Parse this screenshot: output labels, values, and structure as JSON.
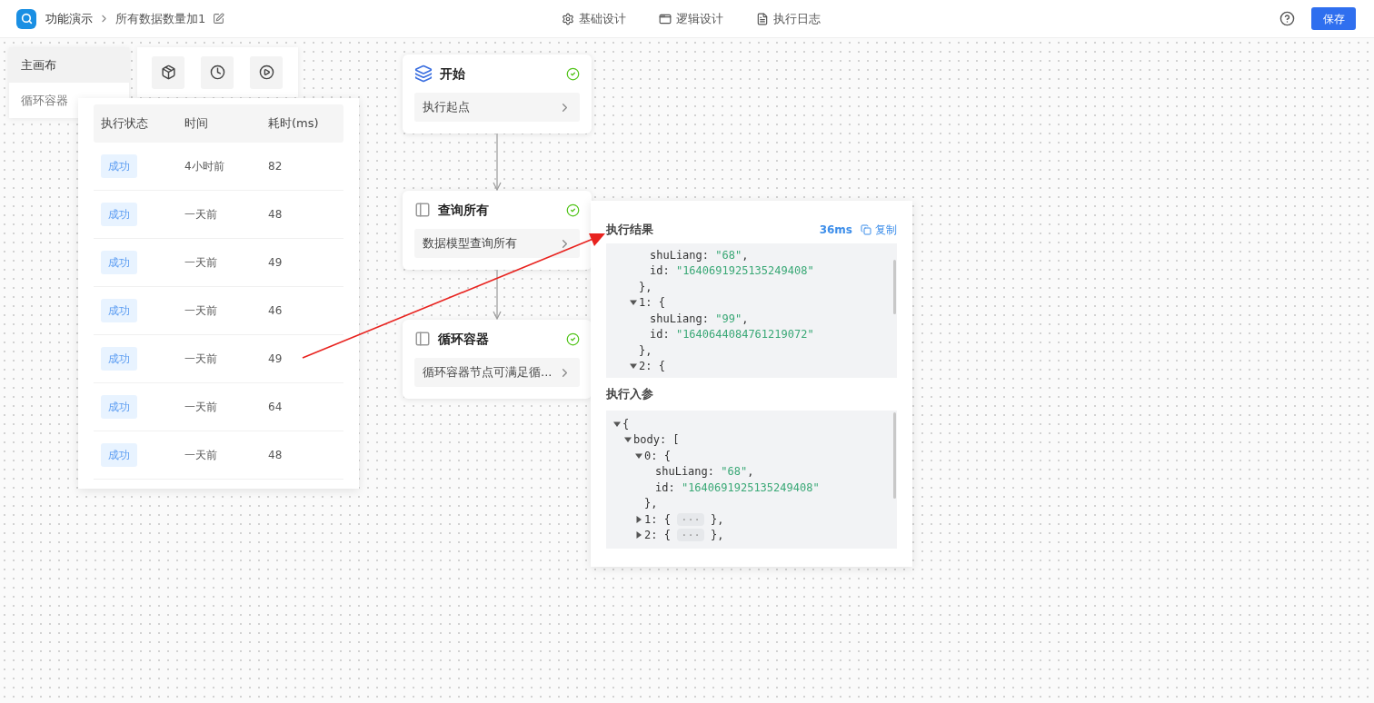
{
  "header": {
    "app_name": "功能演示",
    "page_title": "所有数据数量加1"
  },
  "tabs": [
    {
      "label": "基础设计",
      "kind": "gear",
      "selected": false
    },
    {
      "label": "逻辑设计",
      "kind": "form",
      "selected": false
    },
    {
      "label": "执行日志",
      "kind": "doc",
      "selected": false
    }
  ],
  "save_button": "保存",
  "layers": [
    {
      "label": "主画布",
      "selected": true
    },
    {
      "label": "循环容器",
      "selected": false
    }
  ],
  "toolbar": [
    {
      "kind": "package"
    },
    {
      "kind": "clock"
    },
    {
      "kind": "play"
    }
  ],
  "history": {
    "columns": [
      "执行状态",
      "时间",
      "耗时(ms)"
    ],
    "rows": [
      {
        "status": "成功",
        "time": "4小时前",
        "duration": "82"
      },
      {
        "status": "成功",
        "time": "一天前",
        "duration": "48"
      },
      {
        "status": "成功",
        "time": "一天前",
        "duration": "49"
      },
      {
        "status": "成功",
        "time": "一天前",
        "duration": "46"
      },
      {
        "status": "成功",
        "time": "一天前",
        "duration": "49"
      },
      {
        "status": "成功",
        "time": "一天前",
        "duration": "64"
      },
      {
        "status": "成功",
        "time": "一天前",
        "duration": "48"
      }
    ]
  },
  "nodes": [
    {
      "title": "开始",
      "kind": "layers",
      "done": true,
      "detail": "执行起点"
    },
    {
      "title": "查询所有",
      "kind": "panel",
      "done": true,
      "detail": "数据模型查询所有"
    },
    {
      "title": "循环容器",
      "kind": "panel",
      "done": true,
      "detail": "循环容器节点可满足循..."
    }
  ],
  "result_panel": {
    "result_title": "执行结果",
    "duration": "36ms",
    "copy": "复制",
    "result_tree": [
      {
        "kind": "cut",
        "children": [
          {
            "kind": "pair",
            "key": "shuLiang:",
            "value": "\"68\"",
            "trail": ","
          },
          {
            "kind": "pair",
            "key": "id:",
            "value": "\"1640691925135249408\""
          }
        ],
        "close": "},"
      },
      {
        "kind": "object",
        "key": "1:",
        "expanded": true,
        "open": "{",
        "children": [
          {
            "kind": "pair",
            "key": "shuLiang:",
            "value": "\"99\"",
            "trail": ","
          },
          {
            "kind": "pair",
            "key": "id:",
            "value": "\"1640644084761219072\""
          }
        ],
        "close": "},"
      },
      {
        "kind": "object",
        "key": "2:",
        "expanded": true,
        "open": "{"
      }
    ],
    "params_title": "执行入参",
    "params_tree": [
      {
        "kind": "object",
        "expanded": true,
        "open": "{",
        "children": [
          {
            "kind": "object",
            "key": "body:",
            "expanded": true,
            "open": "[",
            "children": [
              {
                "kind": "object",
                "key": "0:",
                "expanded": true,
                "open": "{",
                "children": [
                  {
                    "kind": "pair",
                    "key": "shuLiang:",
                    "value": "\"68\"",
                    "trail": ","
                  },
                  {
                    "kind": "pair",
                    "key": "id:",
                    "value": "\"1640691925135249408\""
                  }
                ],
                "close": "},"
              },
              {
                "kind": "object",
                "key": "1:",
                "expanded": false,
                "open": "{",
                "ellipsis": "···",
                "close": "},"
              },
              {
                "kind": "object",
                "key": "2:",
                "expanded": false,
                "open": "{",
                "ellipsis": "···",
                "close": "},"
              }
            ]
          }
        ]
      }
    ]
  }
}
